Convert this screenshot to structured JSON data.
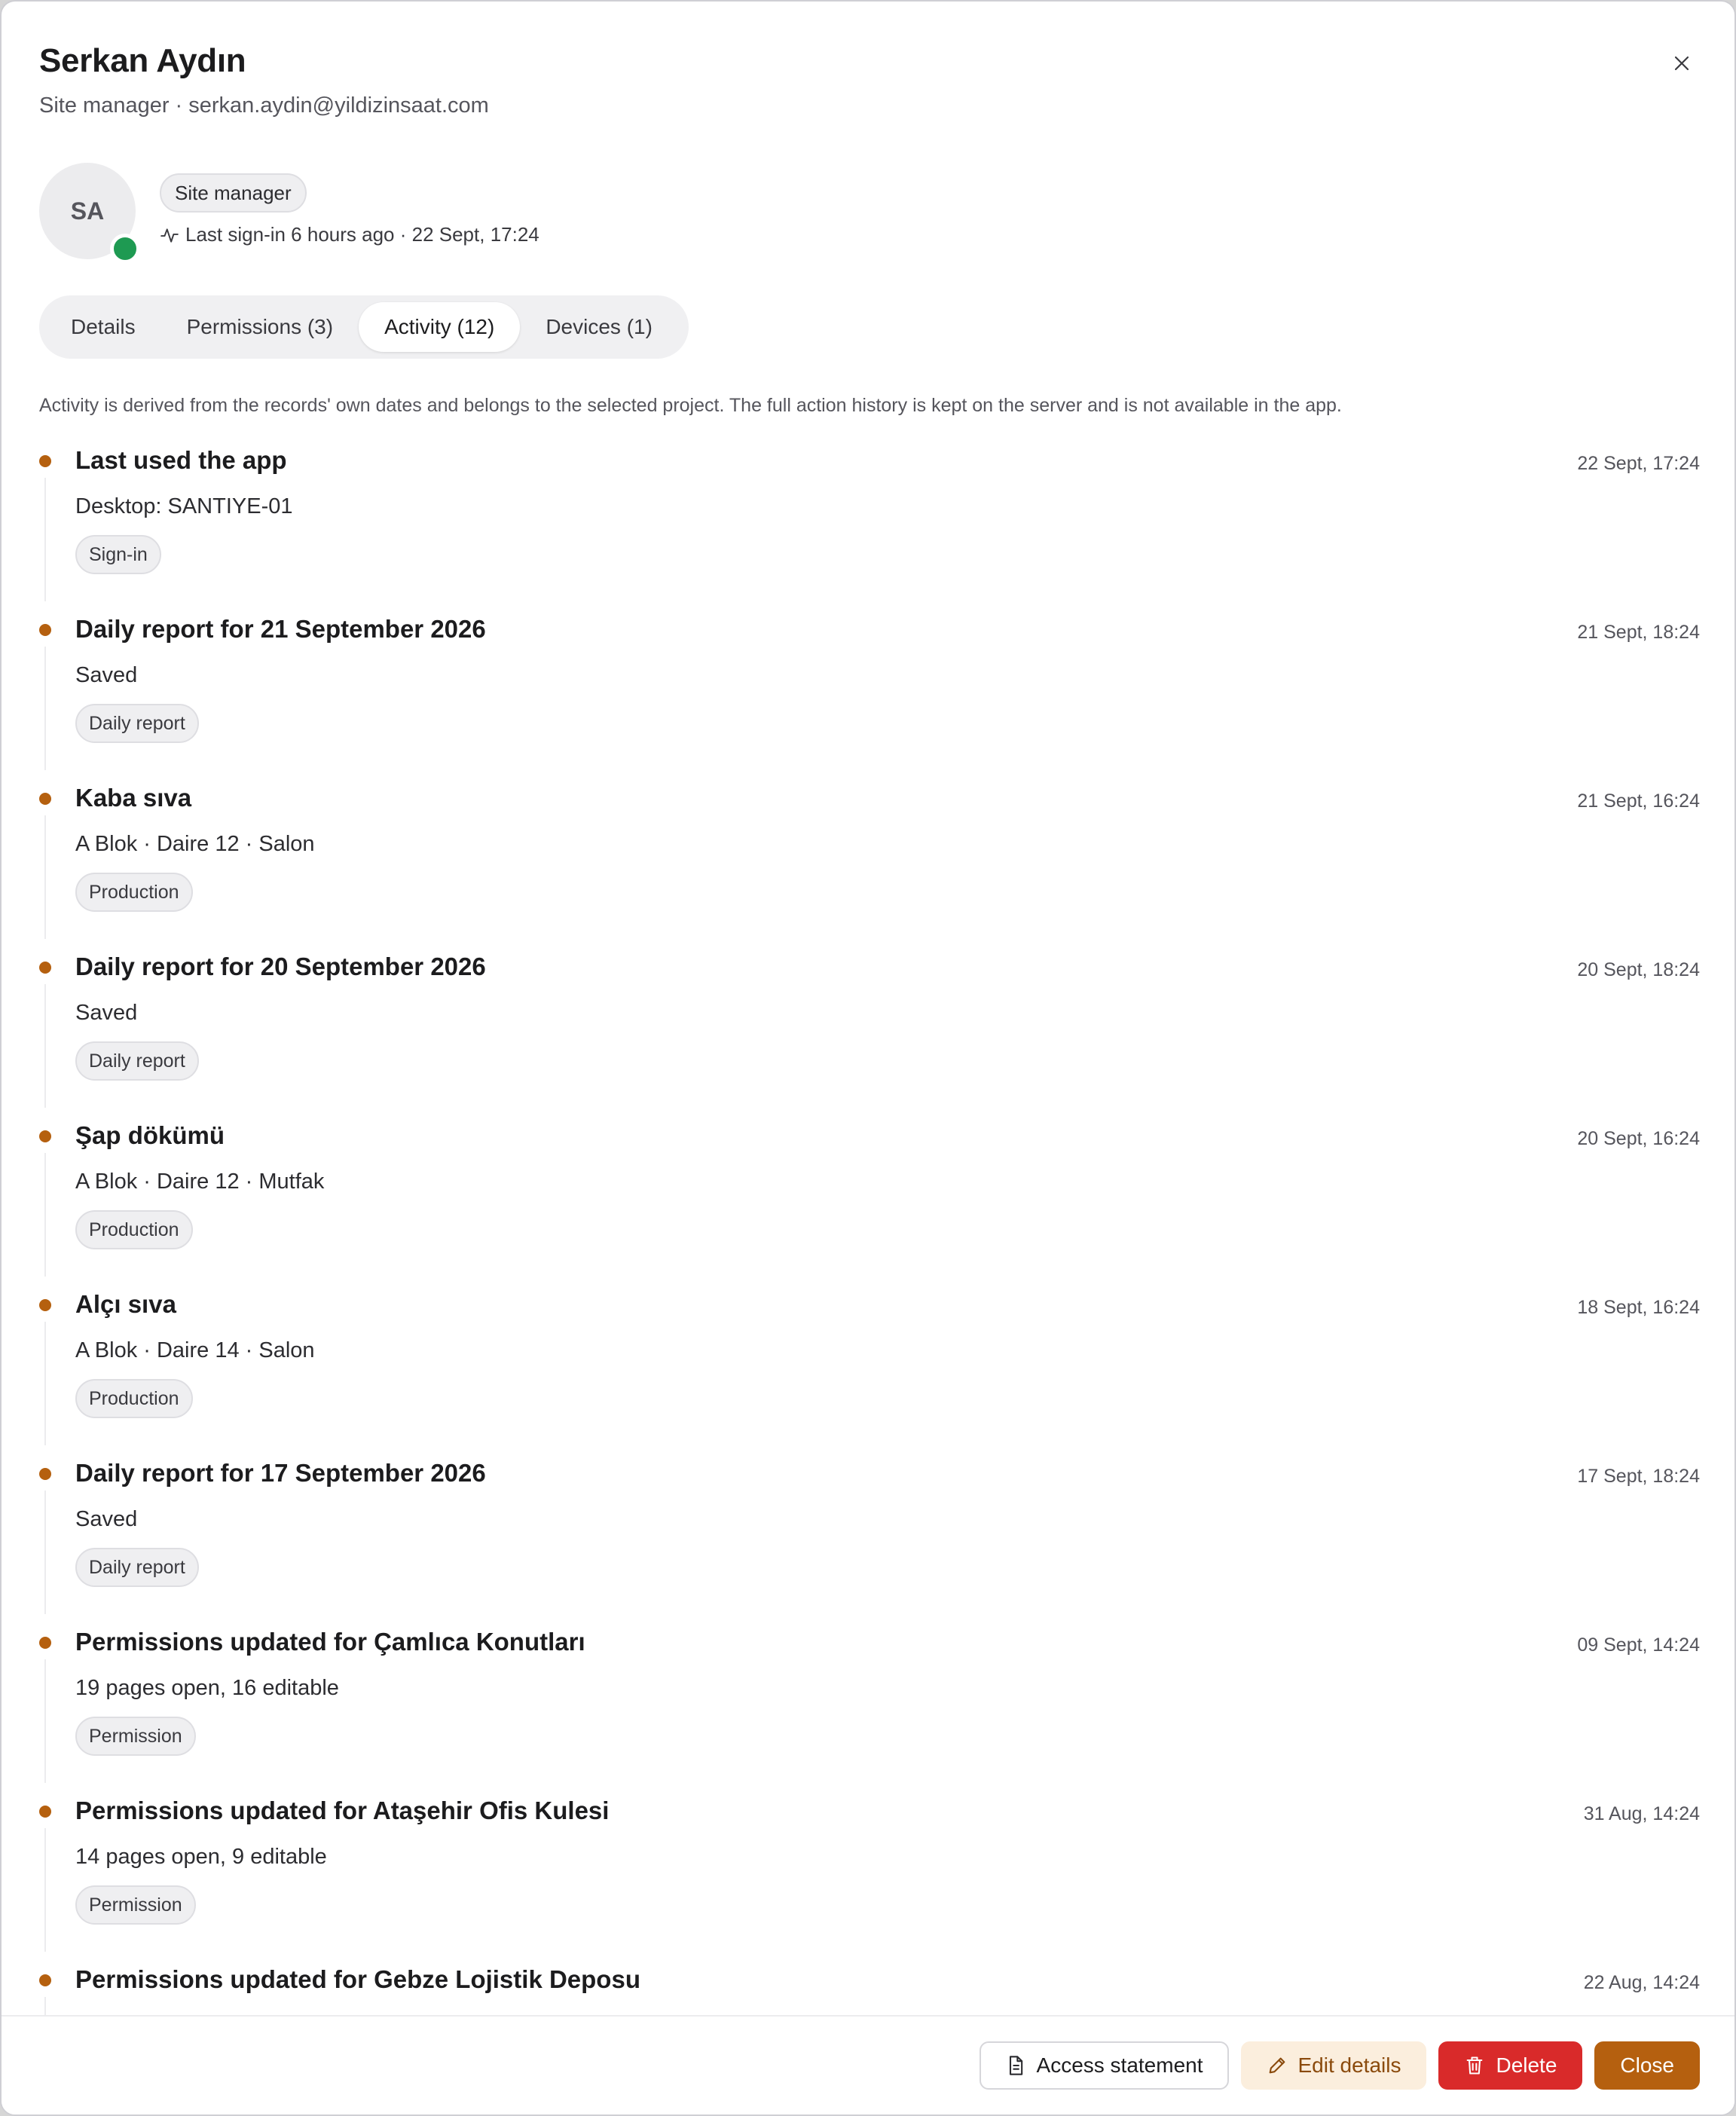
{
  "dialog": {
    "title": "Serkan Aydın",
    "subtitle": "Site manager · serkan.aydin@yildizinsaat.com"
  },
  "profile": {
    "initials": "SA",
    "role_badge": "Site manager",
    "last_signin": "Last sign-in 6 hours ago · 22 Sept, 17:24",
    "status_color": "#1e9a52"
  },
  "tabs": [
    {
      "label": "Details",
      "active": false
    },
    {
      "label": "Permissions (3)",
      "active": false
    },
    {
      "label": "Activity (12)",
      "active": true
    },
    {
      "label": "Devices (1)",
      "active": false
    }
  ],
  "notice": "Activity is derived from the records' own dates and belongs to the selected project. The full action history is kept on the server and is not available in the app.",
  "activity": [
    {
      "title": "Last used the app",
      "subtitle": "Desktop: SANTIYE-01",
      "tag": "Sign-in",
      "time": "22 Sept, 17:24"
    },
    {
      "title": "Daily report for 21 September 2026",
      "subtitle": "Saved",
      "tag": "Daily report",
      "time": "21 Sept, 18:24"
    },
    {
      "title": "Kaba sıva",
      "subtitle": "A Blok · Daire 12 · Salon",
      "tag": "Production",
      "time": "21 Sept, 16:24"
    },
    {
      "title": "Daily report for 20 September 2026",
      "subtitle": "Saved",
      "tag": "Daily report",
      "time": "20 Sept, 18:24"
    },
    {
      "title": "Şap dökümü",
      "subtitle": "A Blok · Daire 12 · Mutfak",
      "tag": "Production",
      "time": "20 Sept, 16:24"
    },
    {
      "title": "Alçı sıva",
      "subtitle": "A Blok · Daire 14 · Salon",
      "tag": "Production",
      "time": "18 Sept, 16:24"
    },
    {
      "title": "Daily report for 17 September 2026",
      "subtitle": "Saved",
      "tag": "Daily report",
      "time": "17 Sept, 18:24"
    },
    {
      "title": "Permissions updated for Çamlıca Konutları",
      "subtitle": "19 pages open, 16 editable",
      "tag": "Permission",
      "time": "09 Sept, 14:24"
    },
    {
      "title": "Permissions updated for Ataşehir Ofis Kulesi",
      "subtitle": "14 pages open, 9 editable",
      "tag": "Permission",
      "time": "31 Aug, 14:24"
    },
    {
      "title": "Permissions updated for Gebze Lojistik Deposu",
      "subtitle": "",
      "tag": "",
      "time": "22 Aug, 14:24"
    }
  ],
  "footer": {
    "access_statement": "Access statement",
    "edit_details": "Edit details",
    "delete": "Delete",
    "close": "Close"
  },
  "colors": {
    "accent": "#b5600f",
    "danger": "#d92a2a",
    "soft_accent_bg": "#fbeedd",
    "online": "#1e9a52"
  },
  "icons": {
    "close": "close-icon",
    "activity": "activity-pulse-icon",
    "document": "document-icon",
    "pencil": "pencil-icon",
    "trash": "trash-icon"
  }
}
